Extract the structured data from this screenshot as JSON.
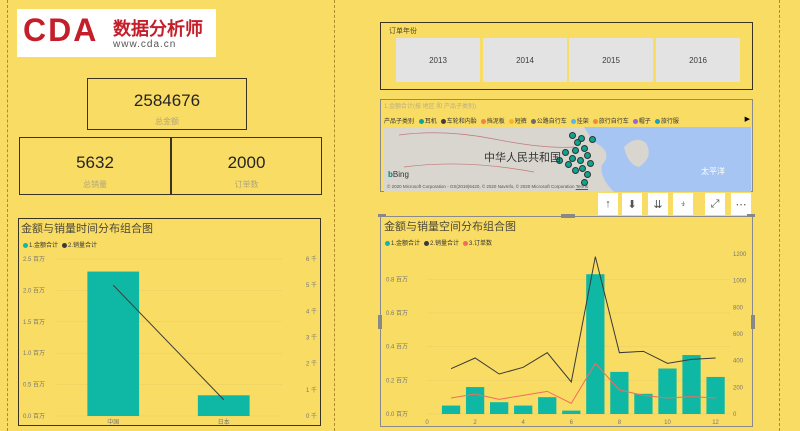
{
  "logo": {
    "brand": "CDA",
    "cn": "数据分析师",
    "url": "www.cda.cn"
  },
  "kpi": {
    "total_amount": "2584676",
    "total_amount_label": "总金额",
    "total_qty": "5632",
    "total_qty_label": "总销量",
    "order_count": "2000",
    "order_count_label": "订单数"
  },
  "slicer": {
    "title": "订单年份",
    "years": [
      "2013",
      "2014",
      "2015",
      "2016"
    ]
  },
  "map": {
    "title": "1.金额合计(按 地区 和 产品子类别)",
    "legend_title": "产品子类别",
    "legend": [
      {
        "name": "耳机",
        "color": "#0ca58f"
      },
      {
        "name": "车轮和内胎",
        "color": "#3e3e3e"
      },
      {
        "name": "挡泥板",
        "color": "#f0834a"
      },
      {
        "name": "短裤",
        "color": "#fbb32c"
      },
      {
        "name": "公路自行车",
        "color": "#6c6c6c"
      },
      {
        "name": "挂架",
        "color": "#54b8e8"
      },
      {
        "name": "旅行自行车",
        "color": "#ef8a38"
      },
      {
        "name": "帽子",
        "color": "#9966cc"
      },
      {
        "name": "旅行服",
        "color": "#1aa1c0"
      }
    ],
    "country_label": "中华人民共和国",
    "ocean_label": "太平洋",
    "bing": "Bing",
    "copyright": "© 2020 Microsoft Corporation - GS(2019)6420, © 2020 NavInfo, © 2020 Microsoft Corporation",
    "terms": "Terms"
  },
  "toolbar": [
    "↑",
    "⬇",
    "⇊",
    "⍖",
    "⤢",
    "⋯"
  ],
  "chart1": {
    "title": "金额与销量时间分布组合图",
    "legend": [
      {
        "name": "1.金额合计",
        "color": "#0fb8a5"
      },
      {
        "name": "2.销量合计",
        "color": "#3a3a3a"
      }
    ],
    "chart_data": {
      "type": "bar",
      "categories": [
        "中国",
        "日本"
      ],
      "series": [
        {
          "name": "1.金额合计",
          "type": "bar",
          "values": [
            2300000,
            330000
          ]
        },
        {
          "name": "2.销量合计",
          "type": "line",
          "values": [
            5000,
            620
          ]
        }
      ],
      "y_left_ticks": [
        "2.5 百万",
        "2.0 百万",
        "1.5 百万",
        "1.0 百万",
        "0.5 百万",
        "0.0 百万"
      ],
      "y_right_ticks": [
        "6 千",
        "5 千",
        "4 千",
        "3 千",
        "2 千",
        "1 千",
        "0 千"
      ],
      "ylim_left": [
        0,
        2500000
      ],
      "ylim_right": [
        0,
        6000
      ]
    }
  },
  "chart2": {
    "title": "金额与销量空间分布组合图",
    "legend": [
      {
        "name": "1.金额合计",
        "color": "#0fb8a5"
      },
      {
        "name": "2.销量合计",
        "color": "#3a3a3a"
      },
      {
        "name": "3.订单数",
        "color": "#f06d5c"
      }
    ],
    "chart_data": {
      "type": "bar",
      "x": [
        1,
        2,
        3,
        4,
        5,
        6,
        7,
        8,
        9,
        10,
        11,
        12
      ],
      "series": [
        {
          "name": "1.金额合计",
          "type": "bar",
          "values": [
            0.05,
            0.16,
            0.07,
            0.05,
            0.1,
            0.02,
            0.83,
            0.25,
            0.12,
            0.27,
            0.35,
            0.22
          ]
        },
        {
          "name": "2.销量合计",
          "type": "line",
          "values": [
            340,
            420,
            300,
            350,
            460,
            240,
            1180,
            460,
            470,
            380,
            410,
            420
          ]
        },
        {
          "name": "3.订单数",
          "type": "line",
          "values": [
            120,
            150,
            110,
            140,
            170,
            80,
            380,
            180,
            140,
            120,
            130,
            120
          ]
        }
      ],
      "x_ticks": [
        "0",
        "2",
        "4",
        "6",
        "8",
        "10",
        "12"
      ],
      "y_left_ticks": [
        "0.8 百万",
        "0.6 百万",
        "0.4 百万",
        "0.2 百万",
        "0.0 百万"
      ],
      "y_right_ticks": [
        "1200",
        "1000",
        "800",
        "600",
        "400",
        "200",
        "0"
      ],
      "xlim": [
        0,
        12.6
      ],
      "ylim_left": [
        0,
        0.95
      ],
      "ylim_right": [
        0,
        1200
      ]
    }
  }
}
